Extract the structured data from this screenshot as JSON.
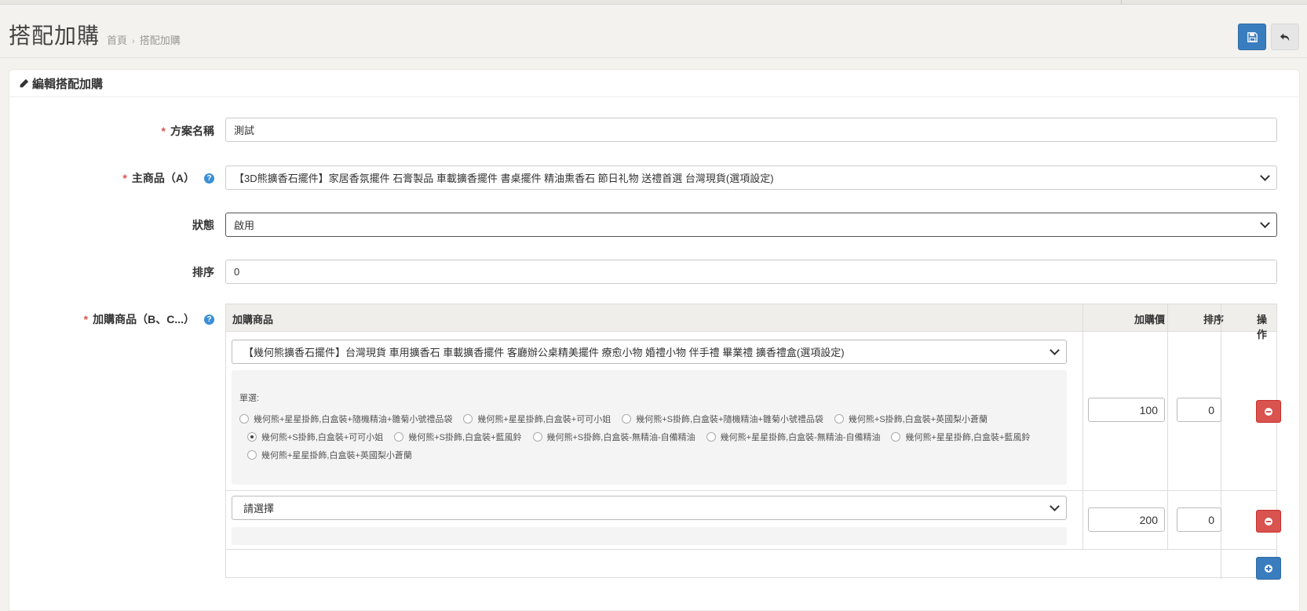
{
  "header": {
    "title": "搭配加購",
    "breadcrumb": [
      "首頁",
      "搭配加購"
    ]
  },
  "card": {
    "title": "編輯搭配加購"
  },
  "form": {
    "name": {
      "label": "方案名稱",
      "value": "測試"
    },
    "main_product": {
      "label": "主商品（A）",
      "value": "【3D熊擴香石擺件】家居香氛擺件 石膏製品 車載擴香擺件 書桌擺件 精油熏香石 節日礼物 送禮首選 台灣現貨(選項設定)"
    },
    "status": {
      "label": "狀態",
      "value": "啟用"
    },
    "sort": {
      "label": "排序",
      "value": "0"
    },
    "addons_label": "加購商品（B、C...）"
  },
  "table": {
    "headers": {
      "product": "加購商品",
      "price": "加購價",
      "sort": "排序",
      "action": "操作"
    },
    "rows": [
      {
        "product": "【幾何熊擴香石擺件】台灣現貨 車用擴香石 車載擴香擺件 客廳辦公桌精美擺件 療愈小物 婚禮小物 伴手禮 畢業禮 擴香禮盒(選項設定)",
        "option_label": "單選:",
        "options": [
          "幾何熊+星星掛飾,白盒裝+隨機精油+雛菊小號禮品袋",
          "幾何熊+星星掛飾,白盒裝+可可小姐",
          "幾何熊+S掛飾,白盒裝+隨機精油+雛菊小號禮品袋",
          "幾何熊+S掛飾,白盒裝+英國梨小蒼蘭",
          "幾何熊+S掛飾,白盒裝+可可小姐",
          "幾何熊+S掛飾,白盒裝+藍風鈴",
          "幾何熊+S掛飾,白盒裝-無精油-自備精油",
          "幾何熊+星星掛飾,白盒裝-無精油-自備精油",
          "幾何熊+星星掛飾,白盒裝+藍風鈴",
          "幾何熊+星星掛飾,白盒裝+英國梨小蒼蘭"
        ],
        "selected_option": 4,
        "price": "100",
        "sort": "0"
      },
      {
        "product": "請選擇",
        "price": "200",
        "sort": "0"
      }
    ]
  },
  "colors": {
    "primary": "#3a7dbf",
    "danger": "#d9534f",
    "required": "#d9534f",
    "help": "#3a8fd6"
  },
  "icons": {
    "save": "save-icon",
    "back": "reply-icon",
    "edit": "pencil-icon",
    "remove": "minus-circle-icon",
    "add": "plus-circle-icon",
    "help": "question-circle-icon"
  }
}
